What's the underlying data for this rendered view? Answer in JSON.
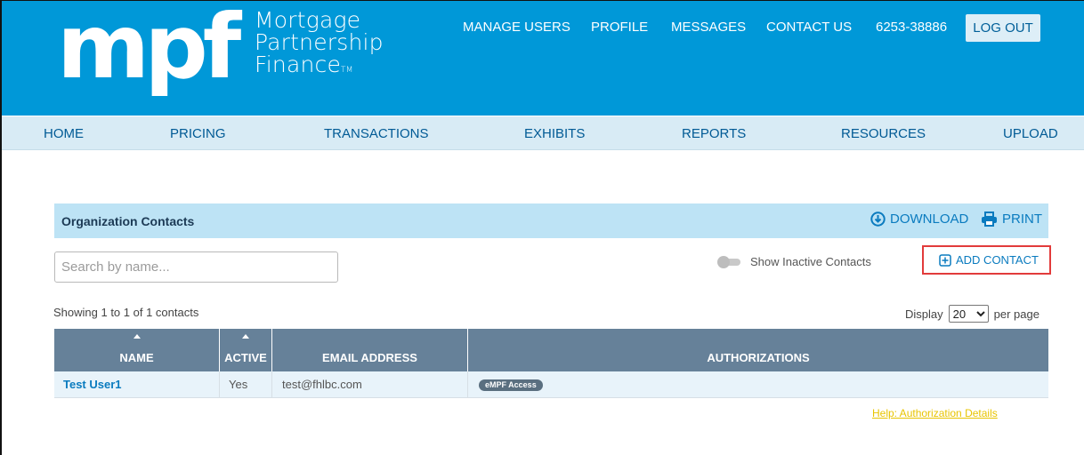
{
  "brand": {
    "logo_letters": "mpf",
    "name_lines": [
      "Mortgage",
      "Partnership",
      "Finance"
    ],
    "trademark": "TM",
    "header_color": "#0098d8"
  },
  "topnav": {
    "items": [
      "MANAGE USERS",
      "PROFILE",
      "MESSAGES",
      "CONTACT US",
      "6253-38886"
    ],
    "logout_label": "LOG OUT"
  },
  "mainnav": {
    "items": [
      "HOME",
      "PRICING",
      "TRANSACTIONS",
      "EXHIBITS",
      "REPORTS",
      "RESOURCES",
      "UPLOAD"
    ]
  },
  "panel": {
    "title": "Organization Contacts",
    "download_label": "DOWNLOAD",
    "print_label": "PRINT"
  },
  "search": {
    "placeholder": "Search by name...",
    "value": ""
  },
  "toggle": {
    "label": "Show Inactive Contacts",
    "on": false
  },
  "add_contact_label": "ADD CONTACT",
  "showing_text": "Showing 1 to 1 of 1 contacts",
  "display": {
    "prefix": "Display",
    "value": "20",
    "suffix": "per page"
  },
  "table": {
    "headers": [
      "NAME",
      "ACTIVE",
      "EMAIL ADDRESS",
      "AUTHORIZATIONS"
    ],
    "rows": [
      {
        "name": "Test User1",
        "active": "Yes",
        "email": "test@fhlbc.com",
        "authorizations": [
          "eMPF Access"
        ]
      }
    ]
  },
  "help_link": "Help: Authorization Details",
  "colors": {
    "accent": "#0a7bbf",
    "highlight_border": "#e23b3b",
    "table_header": "#668199",
    "help_link": "#e8c400"
  }
}
